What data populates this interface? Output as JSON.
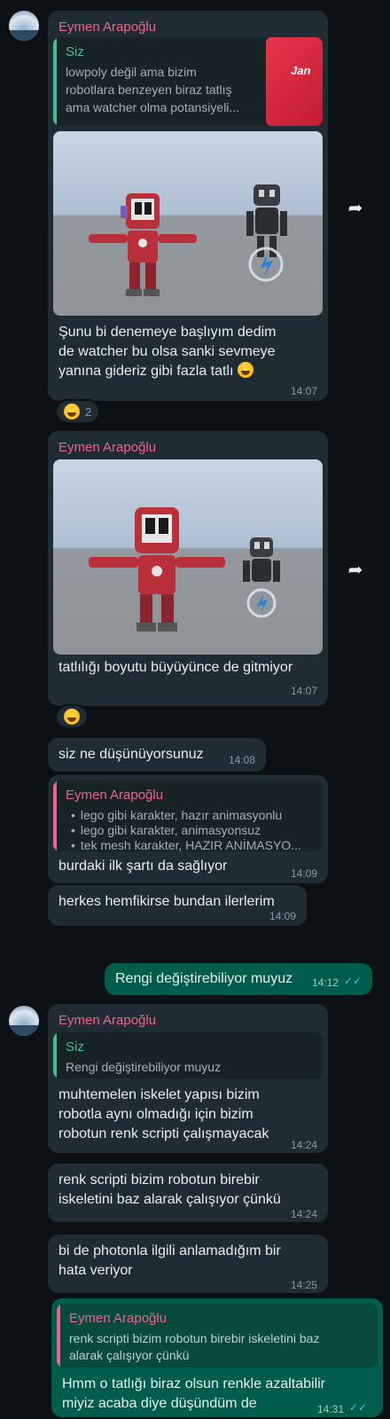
{
  "colors": {
    "background": "#0b1114",
    "incoming_bubble": "#1f2c34",
    "outgoing_bubble": "#005c4b",
    "sender_name": "#f0628e",
    "quote_self": "#3ec28f",
    "quote_other": "#f0628e",
    "read_ticks": "#53bdeb"
  },
  "messages": [
    {
      "sender": "Eymen Arapoğlu",
      "quote_name": "Siz",
      "quote_lines": [
        "lowpoly değil ama bizim",
        "robotlara benzeyen biraz tatlış",
        "ama watcher olma potansiyeli..."
      ],
      "thumb_text": "Jan",
      "text_lines": [
        "Şunu bi denemeye başlıyım dedim",
        "de watcher bu olsa sanki sevmeye",
        "yanına gideriz gibi fazla tatlı"
      ],
      "time": "14:07",
      "reaction_count": "2",
      "forward_icon": "forward-icon"
    },
    {
      "sender": "Eymen Arapoğlu",
      "text": "tatlılığı boyutu büyüyünce de gitmiyor",
      "time": "14:07",
      "forward_icon": "forward-icon"
    },
    {
      "text": "siz ne düşünüyorsunuz",
      "time": "14:08"
    },
    {
      "quote_name": "Eymen Arapoğlu",
      "quote_bullets": [
        "lego gibi karakter, hazır animasyonlu",
        "lego gibi karakter, animasyonsuz",
        "tek mesh karakter, HAZIR ANİMASYO..."
      ],
      "text": "burdaki ilk şartı da sağlıyor",
      "time": "14:09"
    },
    {
      "text": "herkes hemfikirse bundan ilerlerim",
      "time": "14:09"
    },
    {
      "text": "Rengi değiştirebiliyor muyuz",
      "time": "14:12",
      "ticks": "✓✓"
    },
    {
      "sender": "Eymen Arapoğlu",
      "quote_name": "Siz",
      "quote_text": "Rengi değiştirebiliyor muyuz",
      "text_lines": [
        "muhtemelen iskelet yapısı bizim",
        "robotla aynı olmadığı için bizim",
        "robotun renk scripti çalışmayacak"
      ],
      "time": "14:24"
    },
    {
      "text_lines": [
        "renk scripti bizim robotun birebir",
        "iskeletini baz alarak çalışıyor çünkü"
      ],
      "time": "14:24"
    },
    {
      "text_lines": [
        "bi de photonla ilgili anlamadığım bir",
        "hata veriyor"
      ],
      "time": "14:25"
    },
    {
      "quote_name": "Eymen Arapoğlu",
      "quote_lines": [
        "renk scripti bizim robotun birebir iskeletini baz",
        "alarak çalışıyor çünkü"
      ],
      "text_lines": [
        "Hmm o tatlığı biraz olsun renkle azaltabilir",
        "miyiz acaba diye düşündüm de"
      ],
      "time": "14:31",
      "ticks": "✓✓"
    }
  ]
}
